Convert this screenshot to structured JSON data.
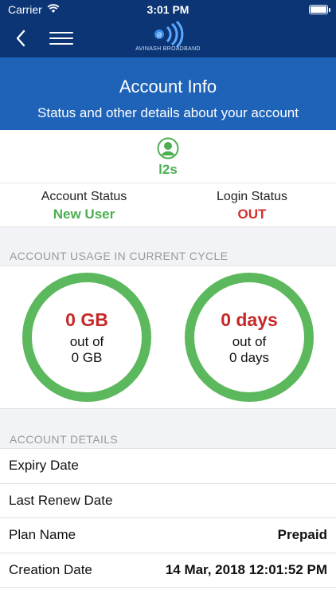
{
  "status_bar": {
    "carrier": "Carrier",
    "time": "3:01 PM"
  },
  "nav": {
    "logo_text": "AVINASH BROADBAND"
  },
  "header": {
    "title": "Account Info",
    "subtitle": "Status and other details about your account"
  },
  "user": {
    "username": "l2s"
  },
  "status": {
    "account_status_label": "Account Status",
    "account_status_value": "New User",
    "login_status_label": "Login Status",
    "login_status_value": "OUT"
  },
  "usage": {
    "section_title": "ACCOUNT USAGE IN CURRENT CYCLE",
    "data_used": "0 GB",
    "data_out_of": "out of",
    "data_total": "0 GB",
    "days_used": "0 days",
    "days_out_of": "out of",
    "days_total": "0 days"
  },
  "details": {
    "section_title": "ACCOUNT DETAILS",
    "rows": [
      {
        "label": "Expiry Date",
        "value": ""
      },
      {
        "label": "Last Renew Date",
        "value": ""
      },
      {
        "label": "Plan Name",
        "value": "Prepaid"
      },
      {
        "label": "Creation Date",
        "value": "14 Mar, 2018 12:01:52 PM"
      }
    ]
  },
  "colors": {
    "nav_bg": "#0b3574",
    "banner_bg": "#1e63b8",
    "green": "#4caf50",
    "red": "#d32f2f",
    "ring": "#5cb85c"
  }
}
